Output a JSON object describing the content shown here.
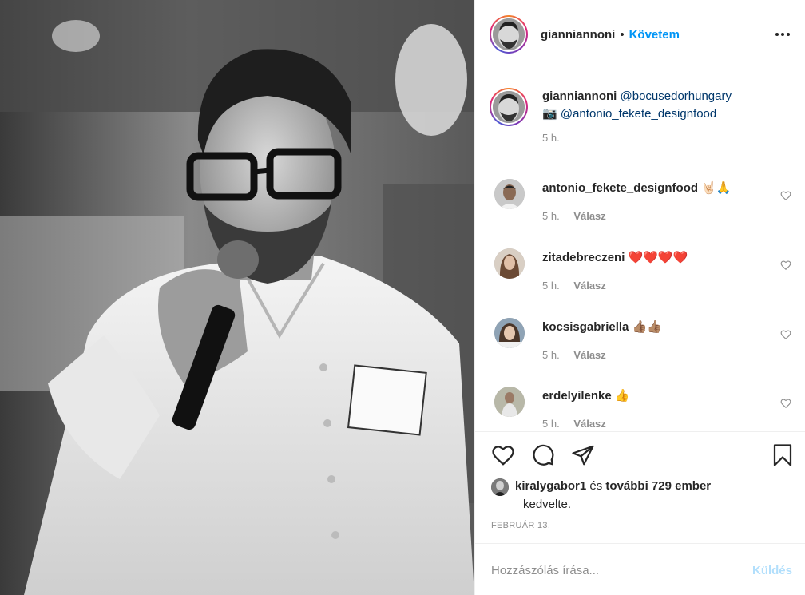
{
  "post": {
    "author": "gianniannoni",
    "separator": "•",
    "follow_label": "Követem",
    "more_icon": "more-horizontal-icon"
  },
  "caption": {
    "username": "gianniannoni",
    "mention1": "@bocusedorhungary",
    "camera_emoji": "📷",
    "mention2": "@antonio_fekete_designfood",
    "time": "5 h."
  },
  "comments": [
    {
      "username": "antonio_fekete_designfood",
      "text": "🤘🏻🙏",
      "time": "5 h.",
      "reply": "Válasz"
    },
    {
      "username": "zitadebreczeni",
      "text": "❤️❤️❤️❤️",
      "time": "5 h.",
      "reply": "Válasz"
    },
    {
      "username": "kocsisgabriella",
      "text": "👍🏽👍🏽",
      "time": "5 h.",
      "reply": "Válasz"
    },
    {
      "username": "erdelyilenke",
      "text": "👍",
      "time": "5 h.",
      "reply": "Válasz"
    }
  ],
  "likes": {
    "user": "kiralygabor1",
    "connector": "és",
    "others": "további 729 ember",
    "suffix": "kedvelte."
  },
  "date": "FEBRUÁR 13.",
  "comment_input": {
    "placeholder": "Hozzászólás írása...",
    "send_label": "Küldés"
  },
  "colors": {
    "link_blue": "#0095f6",
    "mention_blue": "#00376b",
    "muted": "#8e8e8e",
    "send_disabled": "#b2dffc"
  }
}
